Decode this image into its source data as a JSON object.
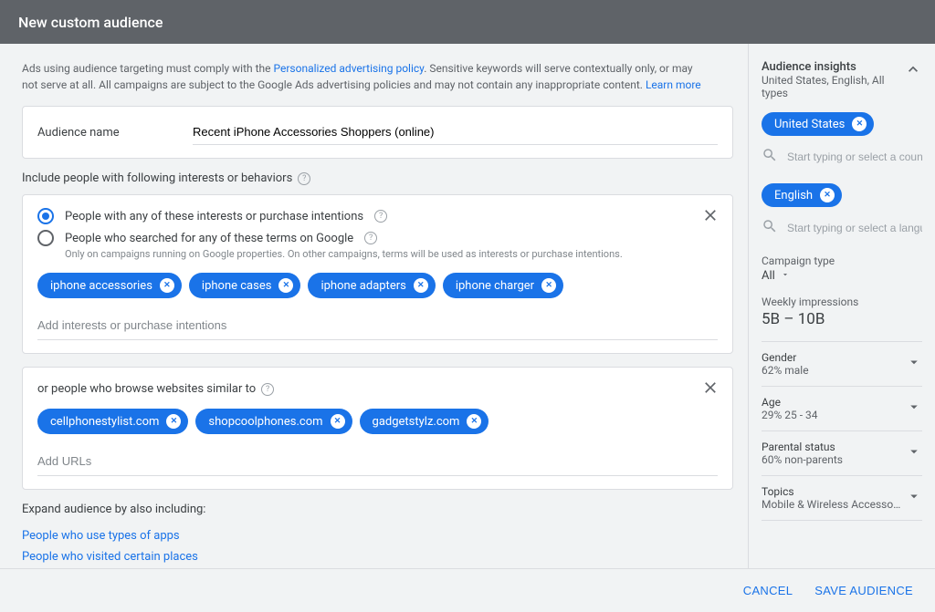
{
  "header": {
    "title": "New custom audience"
  },
  "policy": {
    "pre": "Ads using audience targeting must comply with the ",
    "link1": "Personalized advertising policy",
    "mid": ". Sensitive keywords will serve contextually only, or may not serve at all. All campaigns are subject to the Google Ads advertising policies and may not contain any inappropriate content. ",
    "link2": "Learn more"
  },
  "audienceName": {
    "label": "Audience name",
    "value": "Recent iPhone Accessories Shoppers (online)"
  },
  "includeTitle": "Include people with following interests or behaviors",
  "radios": {
    "interests": "People with any of these interests or purchase intentions",
    "searched": "People who searched for any of these terms on Google",
    "searchedSub": "Only on campaigns running on Google properties. On other campaigns, terms will be used as interests or purchase intentions."
  },
  "interestChips": [
    "iphone accessories",
    "iphone cases",
    "iphone adapters",
    "iphone charger"
  ],
  "interestPlaceholder": "Add interests or purchase intentions",
  "websitesTitle": "or people who browse websites similar to",
  "websiteChips": [
    "cellphonestylist.com",
    "shopcoolphones.com",
    "gadgetstylz.com"
  ],
  "websitePlaceholder": "Add URLs",
  "expand": {
    "title": "Expand audience by also including:",
    "link1": "People who use types of apps",
    "link2": "People who visited certain places"
  },
  "sidebar": {
    "title": "Audience insights",
    "subtitle": "United States, English, All types",
    "countryChip": "United States",
    "countryPlaceholder": "Start typing or select a country",
    "langChip": "English",
    "langPlaceholder": "Start typing or select a langua...",
    "campaignTypeLabel": "Campaign type",
    "campaignTypeValue": "All",
    "impressionsLabel": "Weekly impressions",
    "impressionsValue": "5B – 10B",
    "accordions": [
      {
        "title": "Gender",
        "sub": "62% male"
      },
      {
        "title": "Age",
        "sub": "29% 25 - 34"
      },
      {
        "title": "Parental status",
        "sub": "60% non-parents"
      },
      {
        "title": "Topics",
        "sub": "Mobile & Wireless Accessories, M..."
      }
    ]
  },
  "footer": {
    "cancel": "CANCEL",
    "save": "SAVE AUDIENCE"
  }
}
